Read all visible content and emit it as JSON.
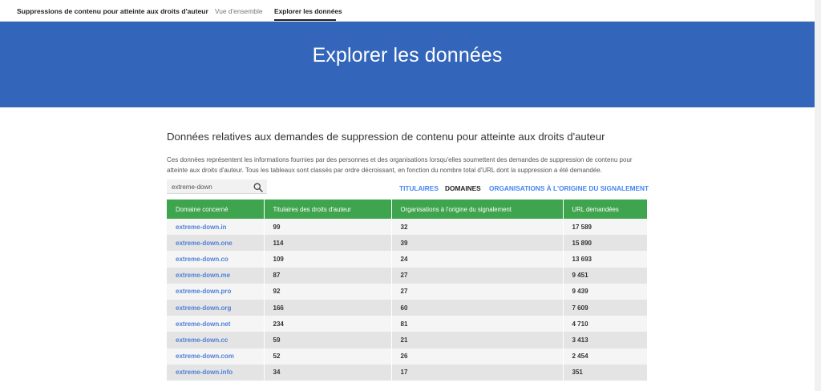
{
  "nav": {
    "brand": "Suppressions de contenu pour atteinte aux droits d'auteur",
    "tabs": [
      {
        "label": "Vue d'ensemble"
      },
      {
        "label": "Explorer les données"
      }
    ]
  },
  "hero": {
    "title": "Explorer les données"
  },
  "main": {
    "section_title": "Données relatives aux demandes de suppression de contenu pour atteinte aux droits d'auteur",
    "description": "Ces données représentent les informations fournies par des personnes et des organisations lorsqu'elles soumettent des demandes de suppression de contenu pour atteinte aux droits d'auteur. Tous les tableaux sont classés par ordre décroissant, en fonction du nombre total d'URL dont la suppression a été demandée.",
    "search": {
      "value": "extreme-down",
      "icon": "search-icon"
    },
    "filters": [
      {
        "label": "TITULAIRES"
      },
      {
        "label": "DOMAINES"
      },
      {
        "label": "ORGANISATIONS À L'ORIGINE DU SIGNALEMENT"
      }
    ],
    "table": {
      "headers": [
        "Domaine concerné",
        "Titulaires des droits d'auteur",
        "Organisations à l'origine du signalement",
        "URL demandées"
      ],
      "rows": [
        [
          "extreme-down.in",
          "99",
          "32",
          "17 589"
        ],
        [
          "extreme-down.one",
          "114",
          "39",
          "15 890"
        ],
        [
          "extreme-down.co",
          "109",
          "24",
          "13 693"
        ],
        [
          "extreme-down.me",
          "87",
          "27",
          "9 451"
        ],
        [
          "extreme-down.pro",
          "92",
          "27",
          "9 439"
        ],
        [
          "extreme-down.org",
          "166",
          "60",
          "7 609"
        ],
        [
          "extreme-down.net",
          "234",
          "81",
          "4 710"
        ],
        [
          "extreme-down.cc",
          "59",
          "21",
          "3 413"
        ],
        [
          "extreme-down.com",
          "52",
          "26",
          "2 454"
        ],
        [
          "extreme-down.info",
          "34",
          "17",
          "351"
        ]
      ]
    }
  },
  "colors": {
    "hero": "#3366bb",
    "table_header": "#3ea44d",
    "link": "#4285f4"
  }
}
